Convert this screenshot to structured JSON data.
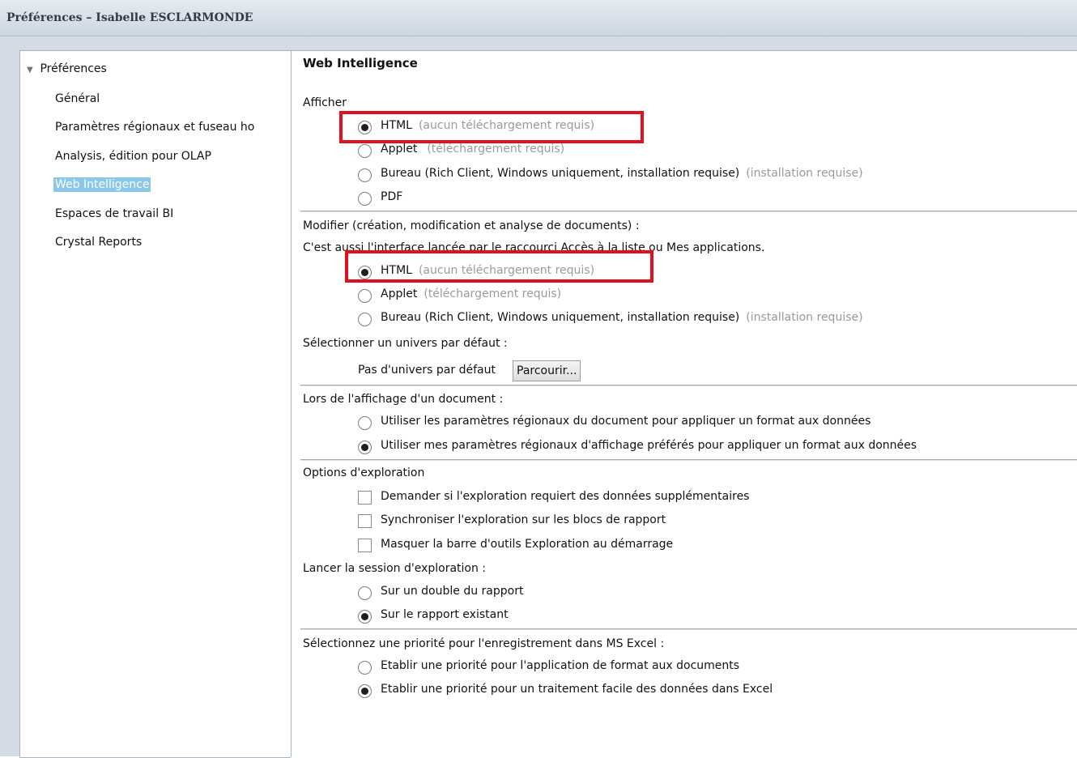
{
  "window": {
    "title": "Préférences – Isabelle ESCLARMONDE"
  },
  "sidebar": {
    "root_label": "Préférences",
    "items": [
      {
        "label": "Général",
        "selected": false
      },
      {
        "label": "Paramètres régionaux et fuseau ho",
        "selected": false
      },
      {
        "label": "Analysis, édition pour OLAP",
        "selected": false
      },
      {
        "label": "Web Intelligence",
        "selected": true
      },
      {
        "label": "Espaces de travail BI",
        "selected": false
      },
      {
        "label": "Crystal Reports",
        "selected": false
      }
    ]
  },
  "main": {
    "section_title": "Web Intelligence",
    "view": {
      "label": "Afficher",
      "options": [
        {
          "label": "HTML",
          "note": "(aucun téléchargement requis)",
          "checked": true
        },
        {
          "label": "Applet",
          "note": "(téléchargement requis)",
          "checked": false
        },
        {
          "label": "Bureau (Rich Client, Windows uniquement, installation requise)",
          "note": "(installation requise)",
          "checked": false
        },
        {
          "label": "PDF",
          "note": "",
          "checked": false
        }
      ]
    },
    "modify": {
      "label": "Modifier (création, modification et analyse de documents) :",
      "sublabel": "C'est aussi l'interface lancée par le raccourci Accès à la liste ou Mes applications.",
      "options": [
        {
          "label": "HTML",
          "note": "(aucun téléchargement requis)",
          "checked": true
        },
        {
          "label": "Applet",
          "note": "(téléchargement requis)",
          "checked": false
        },
        {
          "label": "Bureau (Rich Client, Windows uniquement, installation requise)",
          "note": "(installation requise)",
          "checked": false
        }
      ]
    },
    "universe": {
      "label": "Sélectionner un univers par défaut :",
      "value": "Pas d'univers par défaut",
      "browse_label": "Parcourir..."
    },
    "display_doc": {
      "label": "Lors de l'affichage d'un document :",
      "options": [
        {
          "label": "Utiliser les paramètres régionaux du document pour appliquer un format aux données",
          "checked": false
        },
        {
          "label": "Utiliser mes paramètres régionaux d'affichage préférés pour appliquer un format aux données",
          "checked": true
        }
      ]
    },
    "explore": {
      "label": "Options d'exploration",
      "checkboxes": [
        {
          "label": "Demander si l'exploration requiert des données supplémentaires",
          "checked": false
        },
        {
          "label": "Synchroniser l'exploration sur les blocs de rapport",
          "checked": false
        },
        {
          "label": "Masquer la barre d'outils Exploration au démarrage",
          "checked": false
        }
      ],
      "session_label": "Lancer la session d'exploration :",
      "session_options": [
        {
          "label": "Sur un double du rapport",
          "checked": false
        },
        {
          "label": "Sur le rapport existant",
          "checked": true
        }
      ]
    },
    "excel": {
      "label": "Sélectionnez une priorité pour l'enregistrement dans MS Excel :",
      "options": [
        {
          "label": "Etablir une priorité pour l'application de format aux documents",
          "checked": false
        },
        {
          "label": "Etablir une priorité pour un traitement facile des données dans Excel",
          "checked": true
        }
      ]
    }
  },
  "colors": {
    "highlight_box": "#e0101f",
    "selected_item_bg": "#8ac8ea"
  }
}
